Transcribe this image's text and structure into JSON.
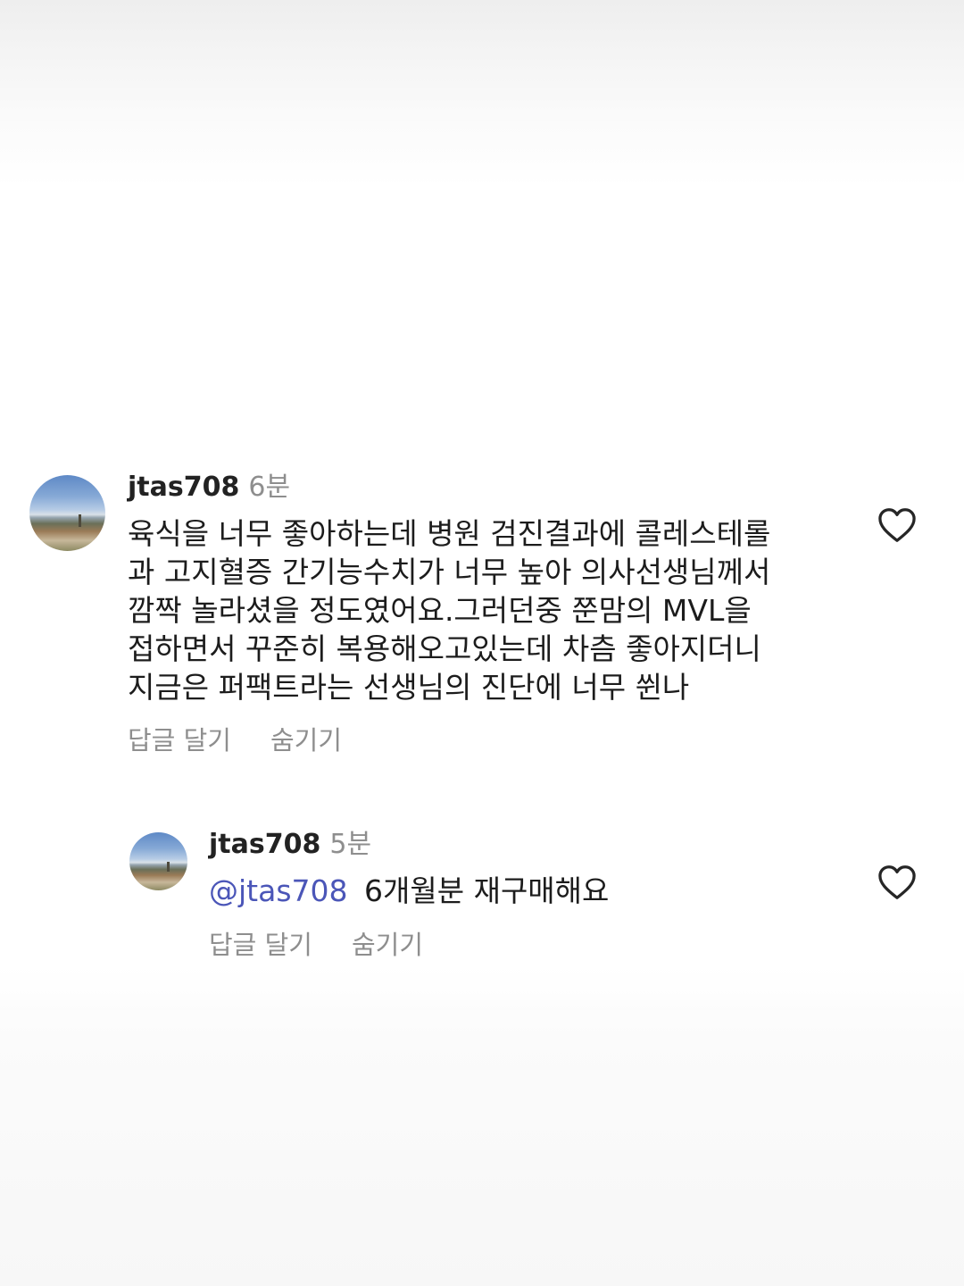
{
  "comments": [
    {
      "username": "jtas708",
      "time": "6분",
      "text": "육식을 너무 좋아하는데 병원 검진결과에 콜레스테롤\n과 고지혈증 간기능수치가 너무 높아 의사선생님께서\n깜짝 놀라셨을 정도였어요.그러던중 쭌맘의 MVL을\n접하면서 꾸준히 복용해오고있는데  차츰 좋아지더니\n지금은 퍼팩트라는 선생님의 진단에 너무 쒼나",
      "reply_label": "답글 달기",
      "hide_label": "숨기기",
      "avatar_icon": "landscape-avatar",
      "like_icon": "heart-outline-icon"
    },
    {
      "username": "jtas708",
      "time": "5분",
      "mention": "@jtas708",
      "text": "6개월분 재구매해요",
      "reply_label": "답글 달기",
      "hide_label": "숨기기",
      "avatar_icon": "landscape-avatar",
      "like_icon": "heart-outline-icon"
    }
  ],
  "colors": {
    "mention": "#4b56b8",
    "secondary_text": "#8e8e8e",
    "primary_text": "#1c1c1c"
  }
}
